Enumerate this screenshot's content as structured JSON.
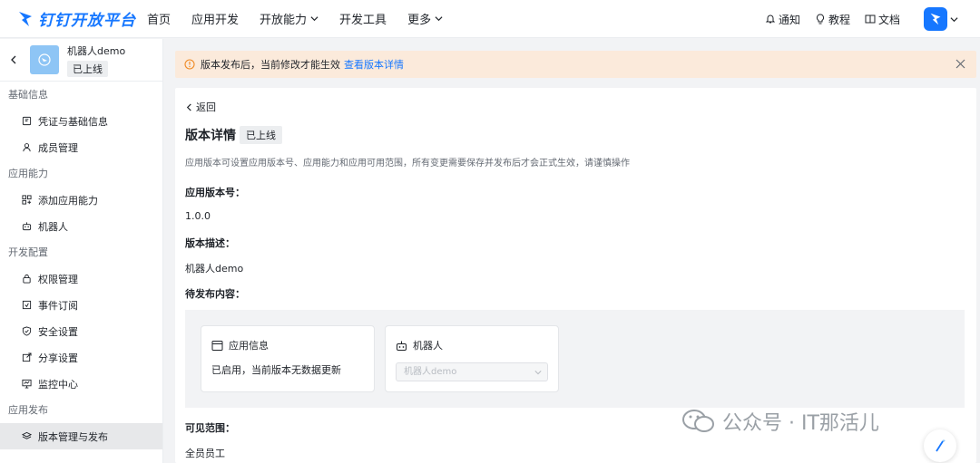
{
  "topnav": {
    "brand": "钉钉开放平台",
    "items": [
      {
        "label": "首页"
      },
      {
        "label": "应用开发"
      },
      {
        "label": "开放能力"
      },
      {
        "label": "开发工具"
      },
      {
        "label": "更多"
      }
    ],
    "right": {
      "notice": "通知",
      "tutorial": "教程",
      "docs": "文档"
    }
  },
  "sidebar": {
    "app_name": "机器人demo",
    "app_status": "已上线",
    "groups": [
      {
        "label": "基础信息",
        "items": [
          {
            "label": "凭证与基础信息",
            "icon": "credential-icon"
          },
          {
            "label": "成员管理",
            "icon": "user-icon"
          }
        ]
      },
      {
        "label": "应用能力",
        "items": [
          {
            "label": "添加应用能力",
            "icon": "apps-add-icon"
          },
          {
            "label": "机器人",
            "icon": "robot-icon"
          }
        ]
      },
      {
        "label": "开发配置",
        "items": [
          {
            "label": "权限管理",
            "icon": "lock-icon"
          },
          {
            "label": "事件订阅",
            "icon": "event-icon"
          },
          {
            "label": "安全设置",
            "icon": "shield-icon"
          },
          {
            "label": "分享设置",
            "icon": "share-icon"
          },
          {
            "label": "监控中心",
            "icon": "monitor-icon"
          }
        ]
      },
      {
        "label": "应用发布",
        "items": [
          {
            "label": "版本管理与发布",
            "icon": "layers-icon"
          }
        ]
      }
    ]
  },
  "banner": {
    "text": "版本发布后，当前修改才能生效",
    "link": "查看版本详情"
  },
  "main": {
    "back": "返回",
    "title": "版本详情",
    "status": "已上线",
    "desc": "应用版本可设置应用版本号、应用能力和应用可用范围，所有变更需要保存并发布后才会正式生效，请谨慎操作",
    "version_label": "应用版本号：",
    "version_value": "1.0.0",
    "desc_label": "版本描述：",
    "desc_value": "机器人demo",
    "pending_label": "待发布内容：",
    "card1": {
      "title": "应用信息",
      "text": "已启用，当前版本无数据更新"
    },
    "card2": {
      "title": "机器人",
      "select": "机器人demo"
    },
    "scope_label": "可见范围：",
    "scope_value": "全员员工"
  },
  "watermark": "公众号 · IT那活儿",
  "colors": {
    "accent": "#1677ff",
    "banner_bg": "#fbeadb",
    "warn": "#f08a24"
  }
}
